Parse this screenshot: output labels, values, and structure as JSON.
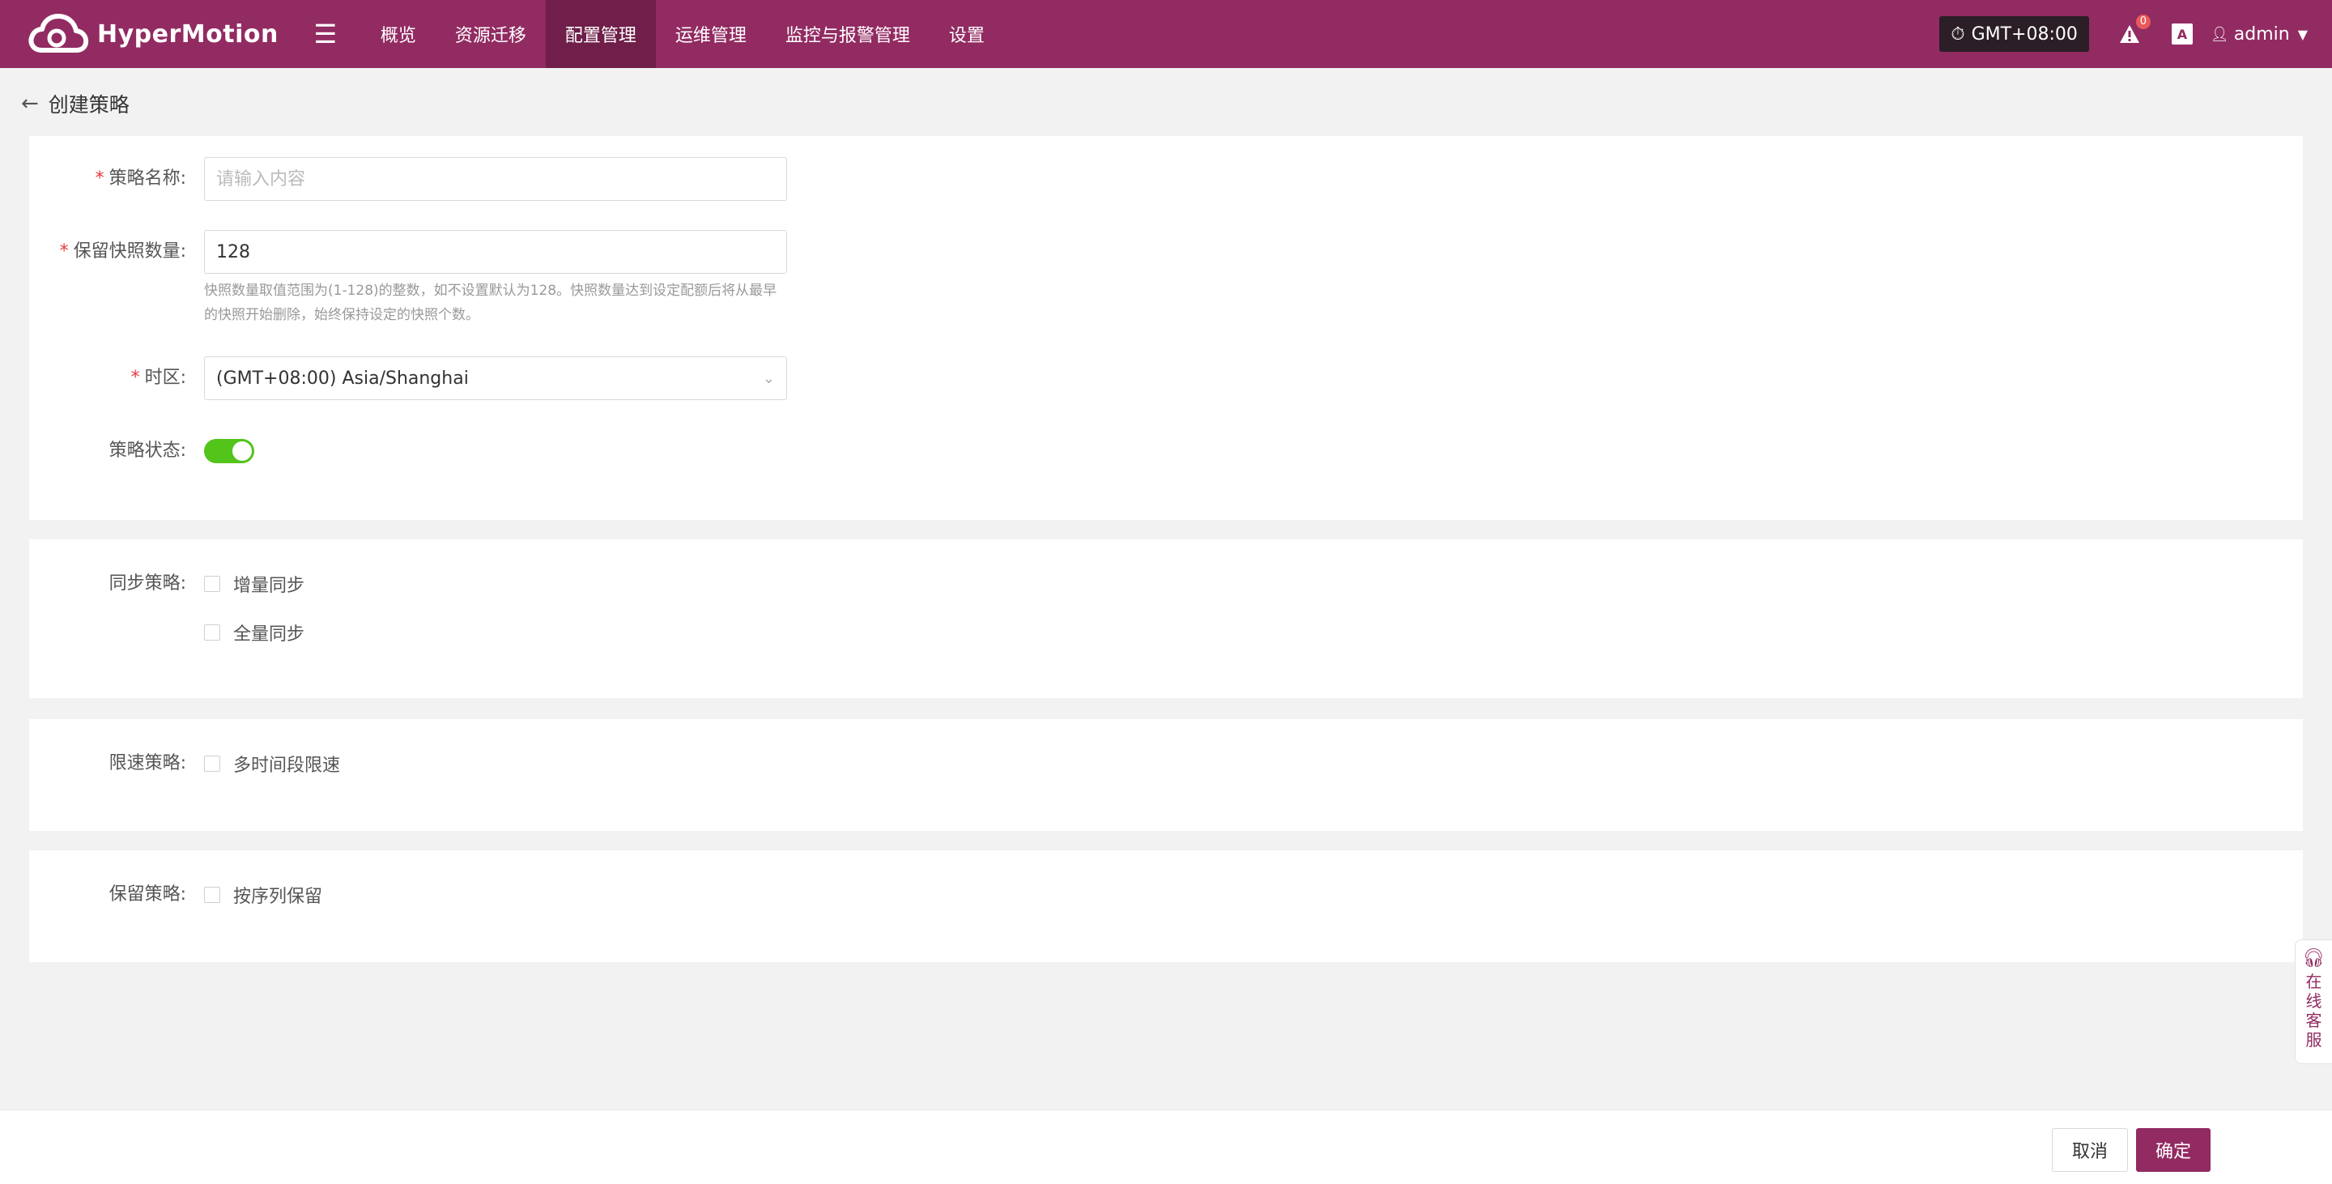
{
  "header": {
    "brand": "HyperMotion",
    "nav": [
      {
        "label": "概览",
        "active": false
      },
      {
        "label": "资源迁移",
        "active": false
      },
      {
        "label": "配置管理",
        "active": true
      },
      {
        "label": "运维管理",
        "active": false
      },
      {
        "label": "监控与报警管理",
        "active": false
      },
      {
        "label": "设置",
        "active": false
      }
    ],
    "timezone": "GMT+08:00",
    "alert_count": "0",
    "lang_icon": "A",
    "user": "admin",
    "colors": {
      "brand": "#922b62",
      "active_tab": "#6f1f49"
    }
  },
  "page": {
    "back_icon": "arrow-left-icon",
    "title": "创建策略"
  },
  "form": {
    "name": {
      "label": "策略名称:",
      "placeholder": "请输入内容",
      "value": ""
    },
    "snapshot": {
      "label": "保留快照数量:",
      "value": "128",
      "hint": "快照数量取值范围为(1-128)的整数，如不设置默认为128。快照数量达到设定配额后将从最早的快照开始删除，始终保持设定的快照个数。"
    },
    "timezone": {
      "label": "时区:",
      "value": "(GMT+08:00) Asia/Shanghai"
    },
    "status": {
      "label": "策略状态:",
      "enabled": true,
      "color": "#52c41a"
    },
    "sync": {
      "label": "同步策略:",
      "options": [
        "增量同步",
        "全量同步"
      ]
    },
    "limit": {
      "label": "限速策略:",
      "options": [
        "多时间段限速"
      ]
    },
    "retain": {
      "label": "保留策略:",
      "options": [
        "按序列保留"
      ]
    }
  },
  "footer": {
    "cancel": "取消",
    "confirm": "确定"
  },
  "service": {
    "label": "在线客服",
    "icon": "headset-icon"
  }
}
